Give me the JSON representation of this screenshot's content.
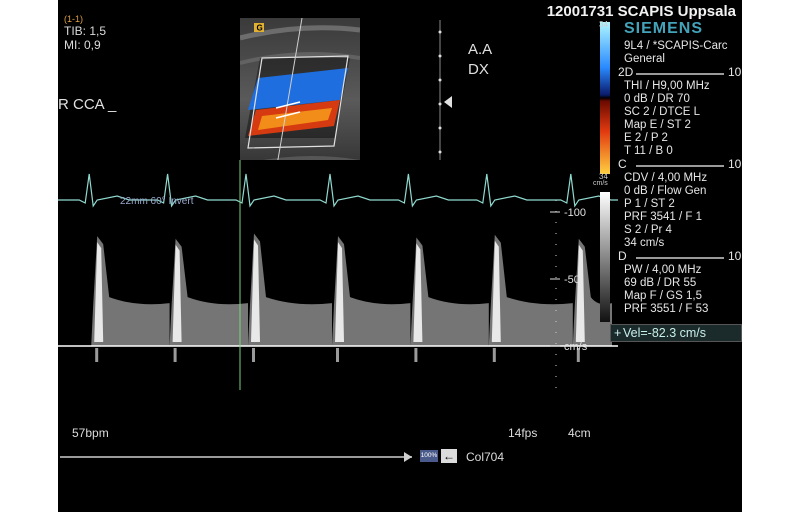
{
  "header": {
    "patient_id": "12001731 SCAPIS Uppsala",
    "frame_counter": "(1-1)",
    "tib": "TIB: 1,5",
    "mi": "MI: 0,9"
  },
  "labels": {
    "vessel": "R CCA _",
    "side": "A.A\nDX",
    "doppler_info": "22mm  60°  Invert",
    "heart_rate": "57bpm",
    "frame_rate": "14fps",
    "depth": "4cm",
    "zoom_badge": "100%",
    "col_code": "Col704"
  },
  "bmode": {
    "marker_glyph": "G"
  },
  "brand": "SIEMENS",
  "probe": {
    "model": "9L4 / *SCAPIS-Carc",
    "preset": "General"
  },
  "color_bar": {
    "top": "34",
    "bottom": "34",
    "unit": "cm/s"
  },
  "sections": [
    {
      "key": "2D",
      "scale": "10",
      "lines": [
        "THI / H9,00 MHz",
        "0 dB / DR 70",
        "SC 2 / DTCE L",
        "Map E / ST 2",
        "E 2 / P 2",
        "T 11 / B 0"
      ]
    },
    {
      "key": "C",
      "scale": "10",
      "lines": [
        "CDV / 4,00 MHz",
        "0 dB / Flow Gen",
        "P 1 / ST 2",
        "PRF 3541 / F 1",
        "S 2 / Pr 4",
        "34 cm/s"
      ]
    },
    {
      "key": "D",
      "scale": "10",
      "lines": [
        "PW / 4,00 MHz",
        "69 dB / DR 55",
        "Map F / GS 1,5",
        "PRF 3551 / F 53"
      ]
    }
  ],
  "measurement": {
    "velocity": "Vel=-82.3 cm/s"
  },
  "scale": {
    "ticks": [
      {
        "value": -100,
        "label": "-100"
      },
      {
        "value": -50,
        "label": "-50"
      },
      {
        "value": 0,
        "label": "cm/s"
      }
    ]
  },
  "colors": {
    "ecg": "#8fd9cf",
    "accent": "#43a3ba",
    "marker": "#e0b030",
    "baseline": "#ffffff"
  },
  "spectral": {
    "baseline_velocity": 0,
    "min_velocity": -100,
    "peaks": [
      {
        "t": 0.07,
        "v": -82
      },
      {
        "t": 0.21,
        "v": -80
      },
      {
        "t": 0.35,
        "v": -84
      },
      {
        "t": 0.5,
        "v": -82
      },
      {
        "t": 0.64,
        "v": -81
      },
      {
        "t": 0.78,
        "v": -83
      },
      {
        "t": 0.93,
        "v": -80
      }
    ]
  }
}
